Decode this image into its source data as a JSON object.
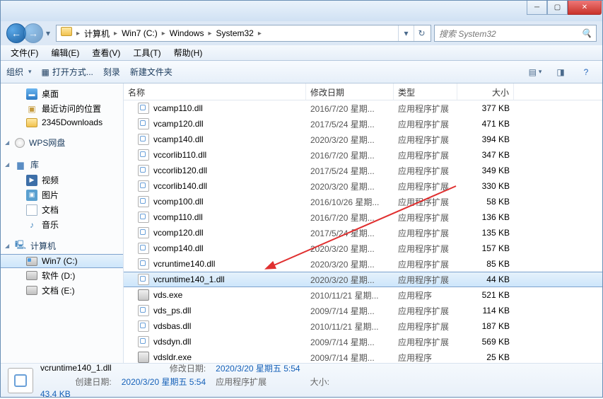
{
  "breadcrumb": [
    "计算机",
    "Win7 (C:)",
    "Windows",
    "System32"
  ],
  "search_placeholder": "搜索 System32",
  "menus": {
    "file": "文件(F)",
    "edit": "编辑(E)",
    "view": "查看(V)",
    "tools": "工具(T)",
    "help": "帮助(H)"
  },
  "toolbar": {
    "org": "组织",
    "open": "打开方式...",
    "burn": "刻录",
    "newfolder": "新建文件夹"
  },
  "columns": {
    "name": "名称",
    "date": "修改日期",
    "type": "类型",
    "size": "大小"
  },
  "nav": {
    "desktop": "桌面",
    "recent": "最近访问的位置",
    "downloads": "2345Downloads",
    "wps": "WPS网盘",
    "lib": "库",
    "video": "视频",
    "pic": "图片",
    "doc": "文档",
    "music": "音乐",
    "computer": "计算机",
    "c": "Win7 (C:)",
    "d": "软件 (D:)",
    "e": "文档 (E:)"
  },
  "files": [
    {
      "name": "vcamp110.dll",
      "date": "2016/7/20 星期...",
      "type": "应用程序扩展",
      "size": "377 KB",
      "icon": "dll"
    },
    {
      "name": "vcamp120.dll",
      "date": "2017/5/24 星期...",
      "type": "应用程序扩展",
      "size": "471 KB",
      "icon": "dll"
    },
    {
      "name": "vcamp140.dll",
      "date": "2020/3/20 星期...",
      "type": "应用程序扩展",
      "size": "394 KB",
      "icon": "dll"
    },
    {
      "name": "vccorlib110.dll",
      "date": "2016/7/20 星期...",
      "type": "应用程序扩展",
      "size": "347 KB",
      "icon": "dll"
    },
    {
      "name": "vccorlib120.dll",
      "date": "2017/5/24 星期...",
      "type": "应用程序扩展",
      "size": "349 KB",
      "icon": "dll"
    },
    {
      "name": "vccorlib140.dll",
      "date": "2020/3/20 星期...",
      "type": "应用程序扩展",
      "size": "330 KB",
      "icon": "dll"
    },
    {
      "name": "vcomp100.dll",
      "date": "2016/10/26 星期...",
      "type": "应用程序扩展",
      "size": "58 KB",
      "icon": "dll"
    },
    {
      "name": "vcomp110.dll",
      "date": "2016/7/20 星期...",
      "type": "应用程序扩展",
      "size": "136 KB",
      "icon": "dll"
    },
    {
      "name": "vcomp120.dll",
      "date": "2017/5/24 星期...",
      "type": "应用程序扩展",
      "size": "135 KB",
      "icon": "dll"
    },
    {
      "name": "vcomp140.dll",
      "date": "2020/3/20 星期...",
      "type": "应用程序扩展",
      "size": "157 KB",
      "icon": "dll"
    },
    {
      "name": "vcruntime140.dll",
      "date": "2020/3/20 星期...",
      "type": "应用程序扩展",
      "size": "85 KB",
      "icon": "dll"
    },
    {
      "name": "vcruntime140_1.dll",
      "date": "2020/3/20 星期...",
      "type": "应用程序扩展",
      "size": "44 KB",
      "icon": "dll",
      "selected": true
    },
    {
      "name": "vds.exe",
      "date": "2010/11/21 星期...",
      "type": "应用程序",
      "size": "521 KB",
      "icon": "exe"
    },
    {
      "name": "vds_ps.dll",
      "date": "2009/7/14 星期...",
      "type": "应用程序扩展",
      "size": "114 KB",
      "icon": "dll"
    },
    {
      "name": "vdsbas.dll",
      "date": "2010/11/21 星期...",
      "type": "应用程序扩展",
      "size": "187 KB",
      "icon": "dll"
    },
    {
      "name": "vdsdyn.dll",
      "date": "2009/7/14 星期...",
      "type": "应用程序扩展",
      "size": "569 KB",
      "icon": "dll"
    },
    {
      "name": "vdsldr.exe",
      "date": "2009/7/14 星期...",
      "type": "应用程序",
      "size": "25 KB",
      "icon": "exe"
    }
  ],
  "details": {
    "filename": "vcruntime140_1.dll",
    "filetype": "应用程序扩展",
    "mod_label": "修改日期:",
    "mod_val": "2020/3/20 星期五 5:54",
    "create_label": "创建日期:",
    "create_val": "2020/3/20 星期五 5:54",
    "size_label": "大小:",
    "size_val": "43.4 KB"
  }
}
